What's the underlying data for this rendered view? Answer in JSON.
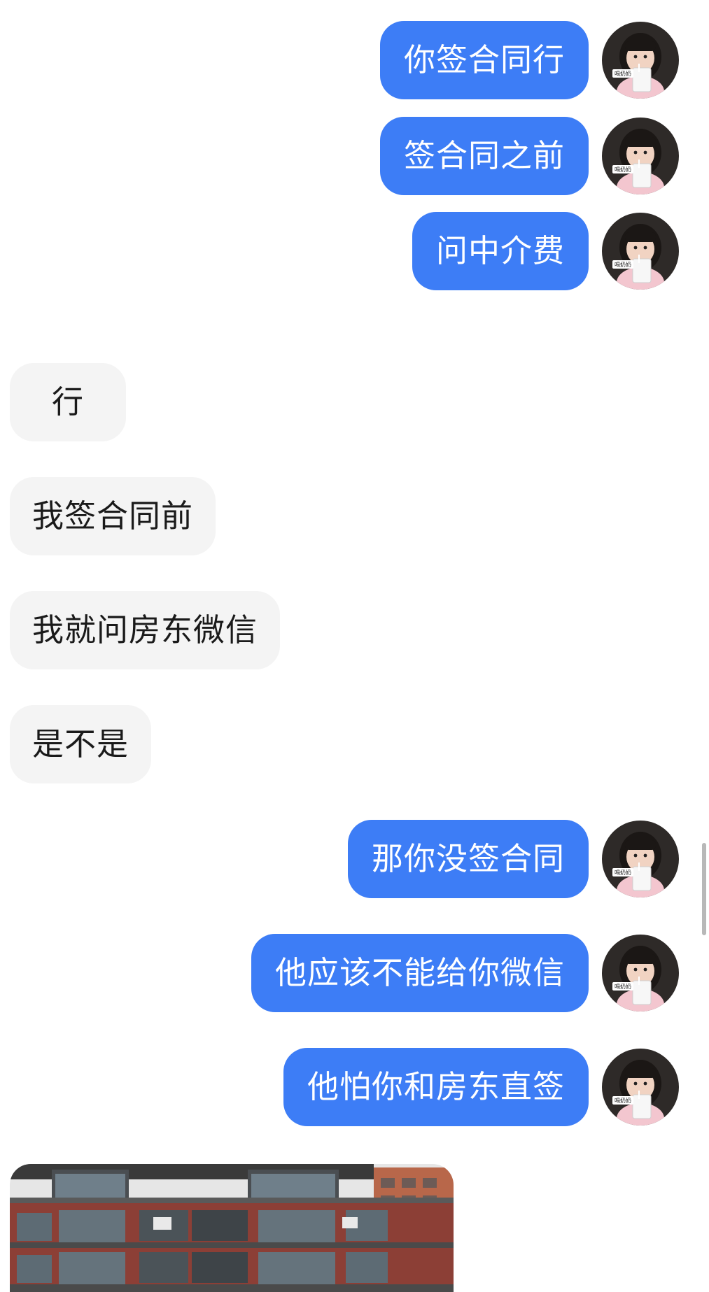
{
  "messages": [
    {
      "side": "out",
      "text": "你签合同行"
    },
    {
      "side": "out",
      "text": "签合同之前"
    },
    {
      "side": "out",
      "text": "问中介费"
    },
    {
      "side": "in",
      "text": "行"
    },
    {
      "side": "in",
      "text": "我签合同前"
    },
    {
      "side": "in",
      "text": "我就问房东微信"
    },
    {
      "side": "in",
      "text": "是不是"
    },
    {
      "side": "out",
      "text": "那你没签合同"
    },
    {
      "side": "out",
      "text": "他应该不能给你微信"
    },
    {
      "side": "out",
      "text": "他怕你和房东直签"
    }
  ],
  "avatar": {
    "icon": "baby-with-milk-carton-avatar",
    "caption": "喝奶奶"
  },
  "image_message": {
    "icon": "apartment-building-photo"
  },
  "colors": {
    "outgoing_bubble": "#3d7df6",
    "incoming_bubble": "#f4f4f4",
    "outgoing_text": "#ffffff",
    "incoming_text": "#1a1a1a"
  }
}
